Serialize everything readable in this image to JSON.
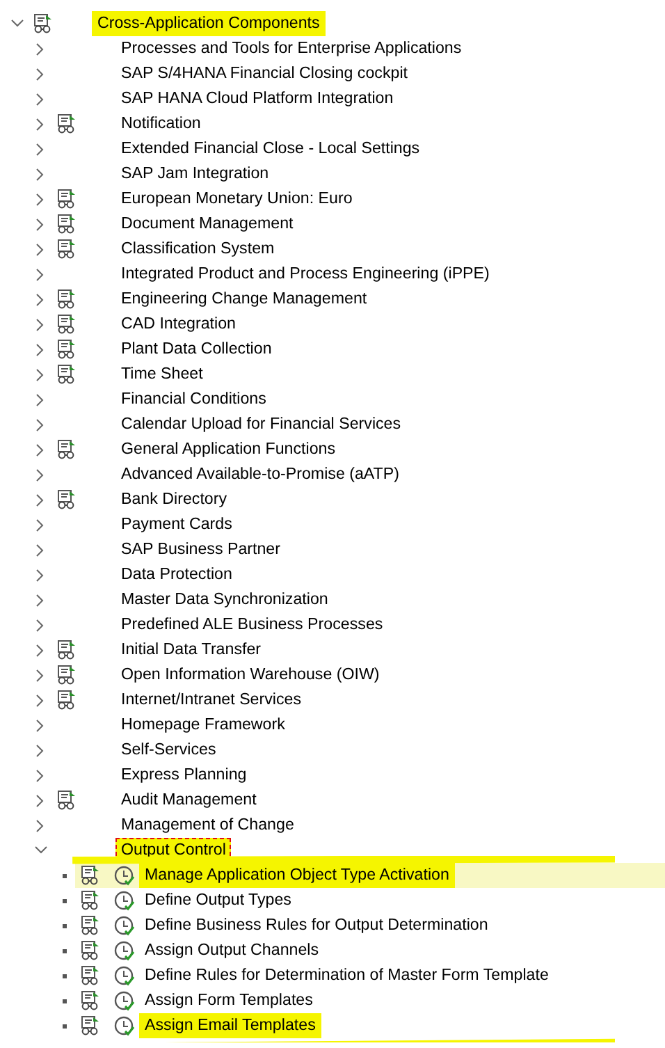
{
  "tree": {
    "label": "Cross-Application Components",
    "expanded": true,
    "documentation": true,
    "highlighted": true,
    "children": [
      {
        "label": "Processes and Tools for Enterprise Applications",
        "expanded": false,
        "documentation": false
      },
      {
        "label": "SAP S/4HANA Financial Closing cockpit",
        "expanded": false,
        "documentation": false
      },
      {
        "label": "SAP HANA Cloud Platform Integration",
        "expanded": false,
        "documentation": false
      },
      {
        "label": "Notification",
        "expanded": false,
        "documentation": true
      },
      {
        "label": "Extended Financial Close - Local Settings",
        "expanded": false,
        "documentation": false
      },
      {
        "label": "SAP Jam Integration",
        "expanded": false,
        "documentation": false
      },
      {
        "label": "European Monetary Union: Euro",
        "expanded": false,
        "documentation": true
      },
      {
        "label": "Document Management",
        "expanded": false,
        "documentation": true
      },
      {
        "label": "Classification System",
        "expanded": false,
        "documentation": true
      },
      {
        "label": "Integrated Product and Process Engineering (iPPE)",
        "expanded": false,
        "documentation": false
      },
      {
        "label": "Engineering Change Management",
        "expanded": false,
        "documentation": true
      },
      {
        "label": "CAD Integration",
        "expanded": false,
        "documentation": true
      },
      {
        "label": "Plant Data Collection",
        "expanded": false,
        "documentation": true
      },
      {
        "label": "Time Sheet",
        "expanded": false,
        "documentation": true
      },
      {
        "label": "Financial Conditions",
        "expanded": false,
        "documentation": false
      },
      {
        "label": "Calendar Upload for Financial Services",
        "expanded": false,
        "documentation": false
      },
      {
        "label": "General Application Functions",
        "expanded": false,
        "documentation": true
      },
      {
        "label": "Advanced Available-to-Promise (aATP)",
        "expanded": false,
        "documentation": false
      },
      {
        "label": "Bank Directory",
        "expanded": false,
        "documentation": true
      },
      {
        "label": "Payment Cards",
        "expanded": false,
        "documentation": false
      },
      {
        "label": "SAP Business Partner",
        "expanded": false,
        "documentation": false
      },
      {
        "label": "Data Protection",
        "expanded": false,
        "documentation": false
      },
      {
        "label": "Master Data Synchronization",
        "expanded": false,
        "documentation": false
      },
      {
        "label": "Predefined ALE Business Processes",
        "expanded": false,
        "documentation": false
      },
      {
        "label": "Initial Data Transfer",
        "expanded": false,
        "documentation": true
      },
      {
        "label": "Open Information Warehouse (OIW)",
        "expanded": false,
        "documentation": true
      },
      {
        "label": "Internet/Intranet Services",
        "expanded": false,
        "documentation": true
      },
      {
        "label": "Homepage Framework",
        "expanded": false,
        "documentation": false
      },
      {
        "label": "Self-Services",
        "expanded": false,
        "documentation": false
      },
      {
        "label": "Express Planning",
        "expanded": false,
        "documentation": false
      },
      {
        "label": "Audit Management",
        "expanded": false,
        "documentation": true
      },
      {
        "label": "Management of Change",
        "expanded": false,
        "documentation": false
      },
      {
        "label": "Output Control",
        "expanded": true,
        "documentation": false,
        "highlighted": true,
        "focused": true,
        "annotated": true,
        "children": [
          {
            "label": "Manage Application Object Type Activation",
            "kind": "activity",
            "documentation": true,
            "selected": true,
            "highlighted": true
          },
          {
            "label": "Define Output Types",
            "kind": "activity",
            "documentation": true,
            "selected": false
          },
          {
            "label": "Define Business Rules for Output Determination",
            "kind": "activity",
            "documentation": true,
            "selected": false
          },
          {
            "label": "Assign Output Channels",
            "kind": "activity",
            "documentation": true,
            "selected": false
          },
          {
            "label": "Define Rules for Determination of Master Form Template",
            "kind": "activity",
            "documentation": true,
            "selected": false
          },
          {
            "label": "Assign Form Templates",
            "kind": "activity",
            "documentation": true,
            "selected": false
          },
          {
            "label": "Assign Email Templates",
            "kind": "activity",
            "documentation": true,
            "selected": false,
            "highlighted": true
          }
        ]
      }
    ]
  }
}
